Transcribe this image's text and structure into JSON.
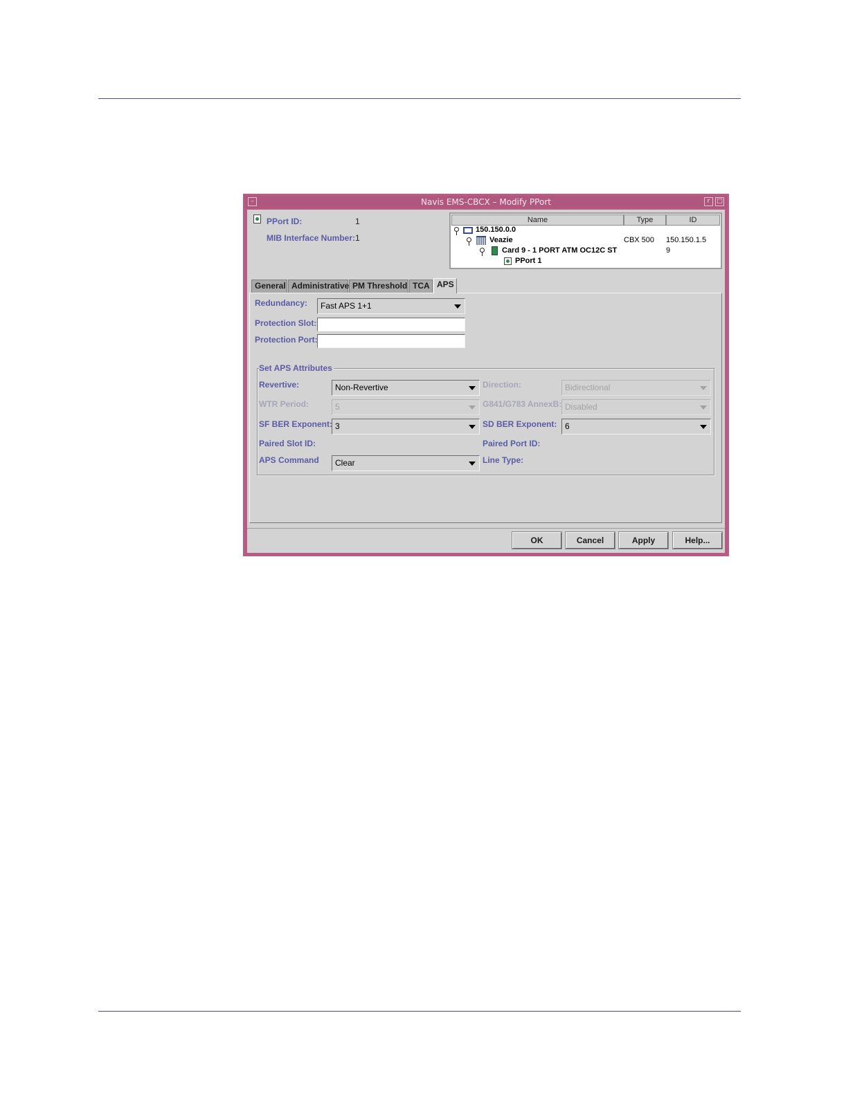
{
  "window": {
    "title": "Navis EMS-CBCX – Modify PPort",
    "accent_color": "#b85c86",
    "menu_button": "–",
    "min_button": "r",
    "max_button": "□"
  },
  "header": {
    "pport_id_label": "PPort ID:",
    "pport_id_value": "1",
    "mib_label": "MIB Interface Number:",
    "mib_value": "1"
  },
  "tree": {
    "columns": [
      "Name",
      "Type",
      "ID"
    ],
    "rows": [
      {
        "name": "150.150.0.0",
        "type": "",
        "id": "",
        "icon": "network-icon"
      },
      {
        "name": "Veazie",
        "type": "CBX 500",
        "id": "150.150.1.5",
        "icon": "switch-icon"
      },
      {
        "name": "Card 9 - 1 PORT ATM OC12C ST",
        "type": "",
        "id": "9",
        "icon": "card-icon"
      },
      {
        "name": "PPort 1",
        "type": "",
        "id": "",
        "icon": "pport-icon"
      }
    ]
  },
  "tabs": [
    {
      "label": "General"
    },
    {
      "label": "Administrative"
    },
    {
      "label": "PM Threshold"
    },
    {
      "label": "TCA"
    },
    {
      "label": "APS",
      "active": true
    }
  ],
  "aps": {
    "redundancy_label": "Redundancy:",
    "redundancy_value": "Fast APS 1+1",
    "protection_slot_label": "Protection Slot:",
    "protection_slot_value": "",
    "protection_port_label": "Protection Port:",
    "protection_port_value": "",
    "group_title": "Set APS Attributes",
    "revertive_label": "Revertive:",
    "revertive_value": "Non-Revertive",
    "direction_label": "Direction:",
    "direction_value": "Bidirectional",
    "wtr_label": "WTR Period:",
    "wtr_value": "5",
    "annexb_label": "G841/G783 AnnexB:",
    "annexb_value": "Disabled",
    "sf_label": "SF BER Exponent:",
    "sf_value": "3",
    "sd_label": "SD BER Exponent:",
    "sd_value": "6",
    "paired_slot_label": "Paired Slot ID:",
    "paired_port_label": "Paired Port ID:",
    "aps_command_label": "APS Command",
    "aps_command_value": "Clear",
    "line_type_label": "Line Type:"
  },
  "buttons": {
    "ok": "OK",
    "cancel": "Cancel",
    "apply": "Apply",
    "help": "Help..."
  }
}
